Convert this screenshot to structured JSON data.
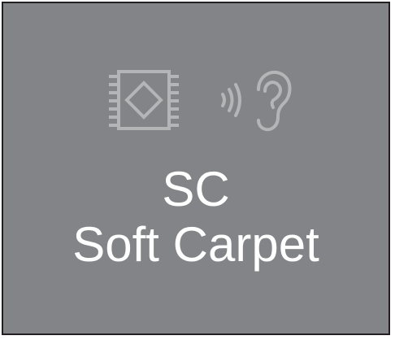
{
  "mode": {
    "code": "SC",
    "name": "Soft Carpet"
  },
  "icons": {
    "left": "soft-carpet-icon",
    "right": "sound-ear-icon"
  },
  "colors": {
    "panel_background": "#838487",
    "icon_color": "#b4b5b7",
    "text_color": "#ffffff",
    "border_color": "#231f20"
  }
}
